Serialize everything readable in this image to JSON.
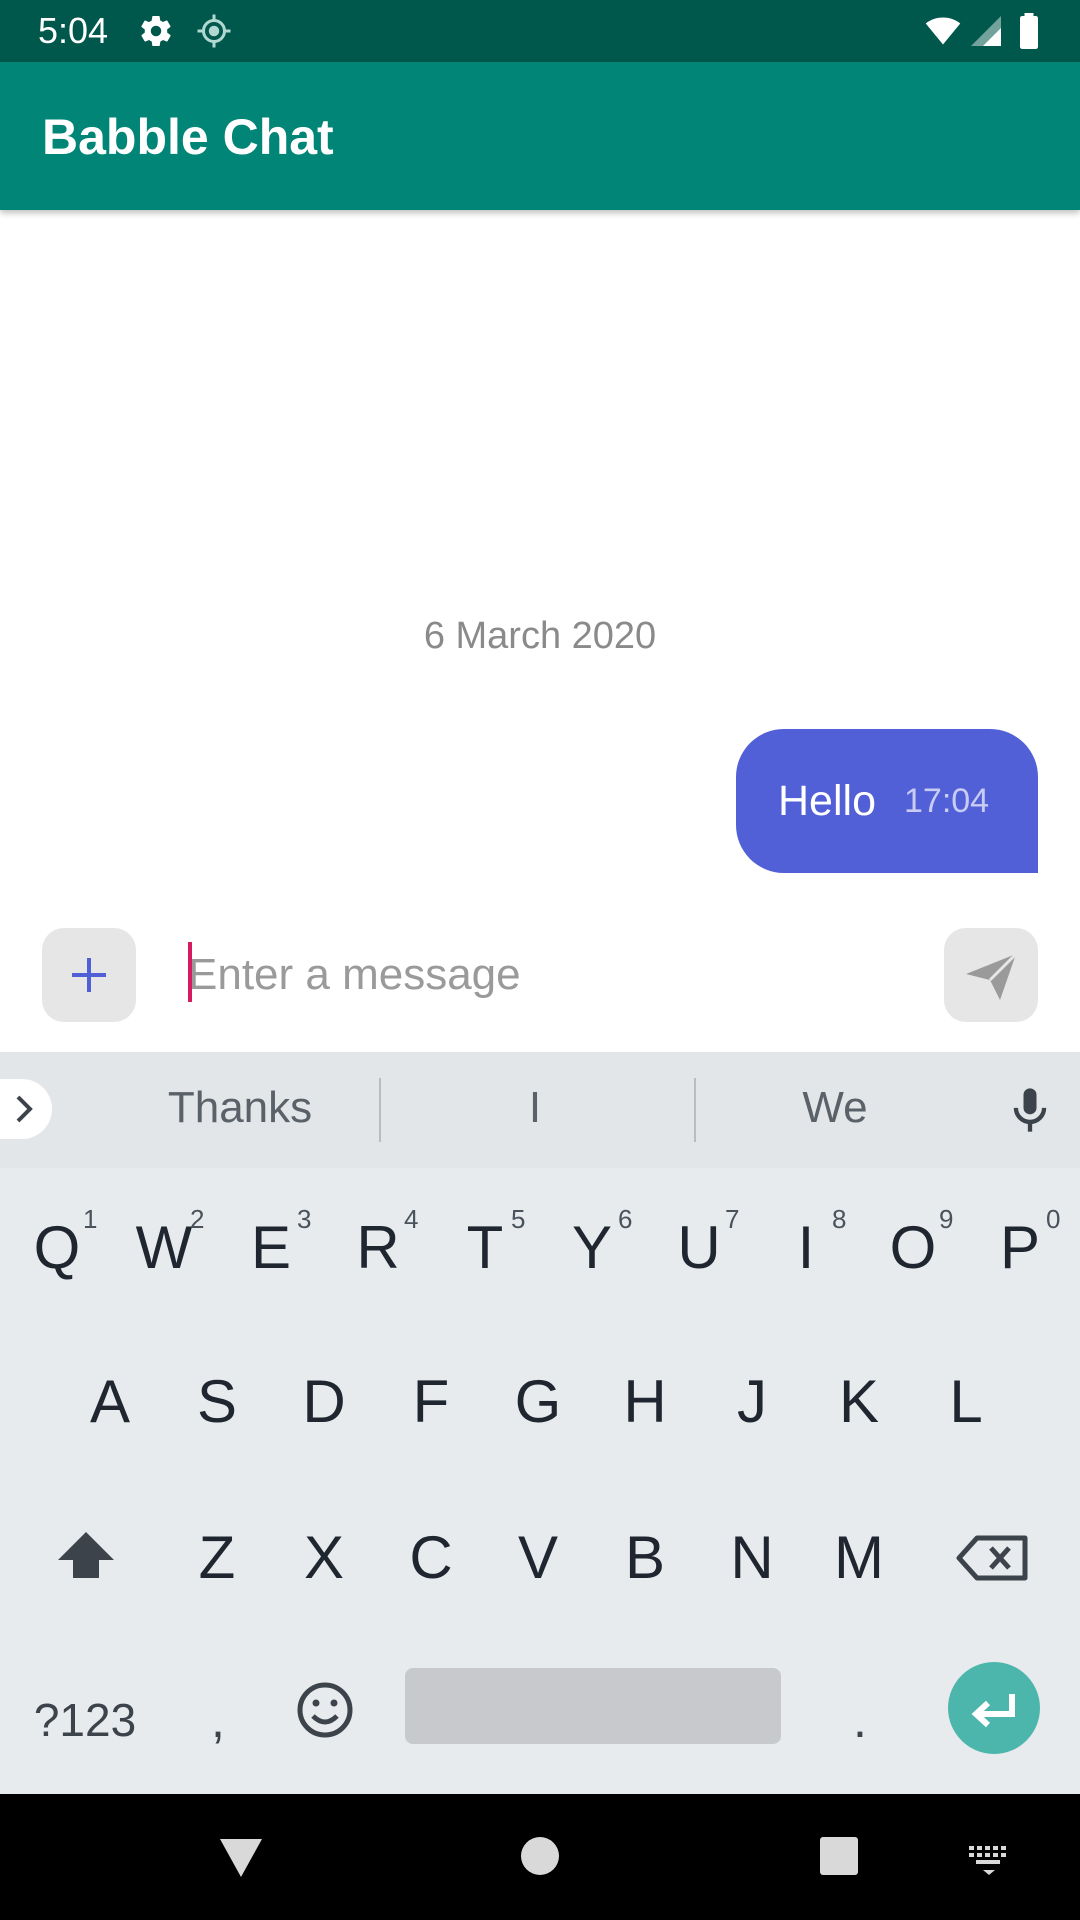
{
  "status_bar": {
    "time": "5:04",
    "left_icons": [
      "gear-icon",
      "location-icon"
    ],
    "right_icons": [
      "wifi-icon",
      "signal-icon",
      "battery-icon"
    ]
  },
  "app_bar": {
    "title": "Babble Chat",
    "color": "#008577"
  },
  "chat": {
    "date_label": "6 March 2020",
    "messages": [
      {
        "text": "Hello",
        "time": "17:04",
        "direction": "outgoing",
        "bubble_color": "#5260d7"
      }
    ]
  },
  "composer": {
    "placeholder": "Enter a message",
    "value": "",
    "attach_icon": "plus-icon",
    "send_icon": "send-icon"
  },
  "keyboard": {
    "suggestions": [
      "Thanks",
      "I",
      "We"
    ],
    "row1": [
      "Q",
      "W",
      "E",
      "R",
      "T",
      "Y",
      "U",
      "I",
      "O",
      "P"
    ],
    "row1_hints": [
      "1",
      "2",
      "3",
      "4",
      "5",
      "6",
      "7",
      "8",
      "9",
      "0"
    ],
    "row2": [
      "A",
      "S",
      "D",
      "F",
      "G",
      "H",
      "J",
      "K",
      "L"
    ],
    "row3": [
      "Z",
      "X",
      "C",
      "V",
      "B",
      "N",
      "M"
    ],
    "symbols_label": "?123",
    "comma_label": ",",
    "period_label": ".",
    "enter_color": "#4db6ac"
  },
  "nav_bar": {
    "icons": [
      "back-icon",
      "home-icon",
      "recents-icon",
      "keyboard-switch-icon"
    ]
  }
}
